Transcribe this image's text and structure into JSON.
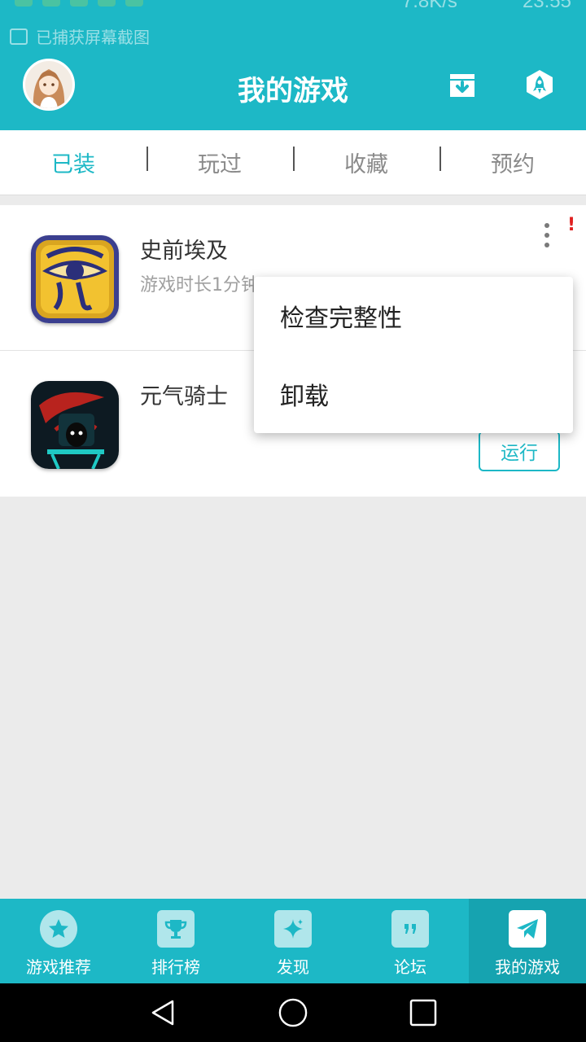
{
  "status_bar": {
    "speed": "7.8K/s",
    "time": "23:55",
    "toast": "已捕获屏幕截图"
  },
  "header": {
    "title": "我的游戏",
    "icons": [
      "avatar",
      "download-box-icon",
      "rocket-icon"
    ]
  },
  "tabs": [
    {
      "label": "已装",
      "active": true
    },
    {
      "label": "玩过",
      "active": false
    },
    {
      "label": "收藏",
      "active": false
    },
    {
      "label": "预约",
      "active": false
    }
  ],
  "games": [
    {
      "name": "史前埃及",
      "subtitle": "游戏时长1分钟",
      "alert": "!",
      "icon": "eye-of-horus-icon"
    },
    {
      "name": "元气骑士",
      "run_label": "运行",
      "icon": "soul-knight-icon"
    }
  ],
  "context_menu": {
    "items": [
      "检查完整性",
      "卸载"
    ]
  },
  "bottom_nav": [
    {
      "label": "游戏推荐",
      "icon": "star-icon",
      "active": false
    },
    {
      "label": "排行榜",
      "icon": "trophy-icon",
      "active": false
    },
    {
      "label": "发现",
      "icon": "sparkle-icon",
      "active": false
    },
    {
      "label": "论坛",
      "icon": "quote-bubble-icon",
      "active": false
    },
    {
      "label": "我的游戏",
      "icon": "paper-plane-icon",
      "active": true
    }
  ],
  "colors": {
    "accent": "#1db8c6",
    "accent_dark": "#16a3b0",
    "alert": "#e02020"
  }
}
